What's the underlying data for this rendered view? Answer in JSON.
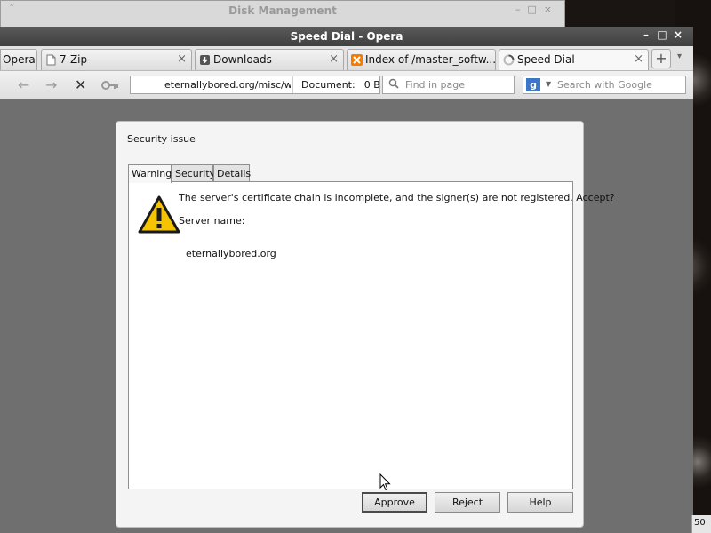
{
  "background_window": {
    "title": "Disk Management",
    "corner_mark": "*",
    "controls": [
      "–",
      "□",
      "×"
    ]
  },
  "window": {
    "title": "Speed Dial - Opera",
    "controls": [
      "–",
      "□",
      "×"
    ]
  },
  "tabs": [
    {
      "label": "Opera",
      "icon": "opera-menu"
    },
    {
      "label": "7-Zip",
      "icon": "page-icon"
    },
    {
      "label": "Downloads",
      "icon": "download-icon"
    },
    {
      "label": "Index of /master_softw...",
      "icon": "xampp-icon"
    },
    {
      "label": "Speed Dial",
      "icon": "loading-icon",
      "active": true
    }
  ],
  "tab_close": "×",
  "new_tab": "+",
  "tab_menu": "▾",
  "toolbar": {
    "back": "←",
    "forward": "→",
    "stop": "✕",
    "url": "eternallybored.org/misc/wget",
    "document_label": "Document:",
    "document_value": "0 B",
    "find_placeholder": "Find in page",
    "search_placeholder": "Search with Google",
    "search_engine_letter": "g"
  },
  "dialog": {
    "title": "Security issue",
    "tabs": [
      "Warning",
      "Security",
      "Details"
    ],
    "active_tab": "Warning",
    "message": "The server's certificate chain is incomplete, and the signer(s) are not registered. Accept?",
    "server_name_label": "Server name:",
    "server_name": "eternallybored.org",
    "buttons": {
      "approve": "Approve",
      "reject": "Reject",
      "help": "Help"
    }
  },
  "taskbar_fragment": "50",
  "colors": {
    "titlebar": "#4a4a4a",
    "content_bg": "#6f6f6f",
    "warning_yellow": "#f5c400"
  }
}
